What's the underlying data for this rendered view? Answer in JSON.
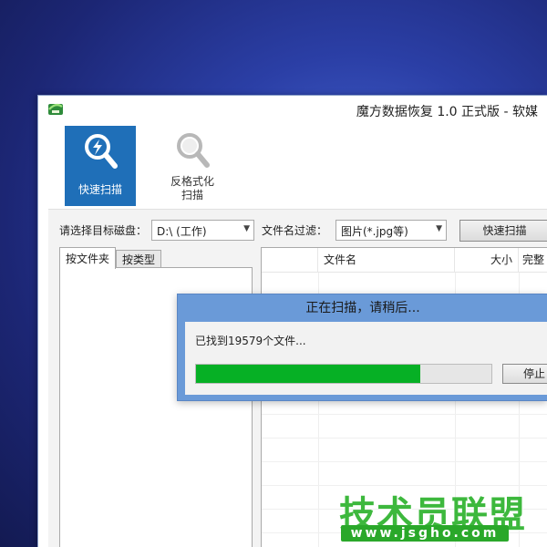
{
  "window": {
    "title": "魔方数据恢复 1.0 正式版 - 软媒"
  },
  "toolbar": {
    "quick_scan_label": "快速扫描",
    "unformat_label_line1": "反格式化",
    "unformat_label_line2": "扫描",
    "quick_scan_icon": "magnifier-lightning-icon",
    "unformat_icon": "magnifier-icon"
  },
  "controls": {
    "disk_label": "请选择目标磁盘：",
    "disk_value": "D:\\ (工作)",
    "filter_label": "文件名过滤：",
    "filter_value": "图片(*.jpg等)",
    "scan_button": "快速扫描"
  },
  "tabs": [
    {
      "label": "按文件夹"
    },
    {
      "label": "按类型"
    }
  ],
  "file_list": {
    "columns": [
      "",
      "文件名",
      "大小",
      "完整"
    ]
  },
  "dialog": {
    "title": "正在扫描，请稍后...",
    "found_text": "已找到19579个文件...",
    "progress": 0.76,
    "stop_button": "停止"
  },
  "watermark": {
    "text": "技术员联盟",
    "url": "www.jsgho.com"
  },
  "colors": {
    "accent": "#1f6fb8",
    "progress": "#06b025",
    "dialog_frame": "#6a9ad8",
    "watermark": "#3db83d"
  }
}
